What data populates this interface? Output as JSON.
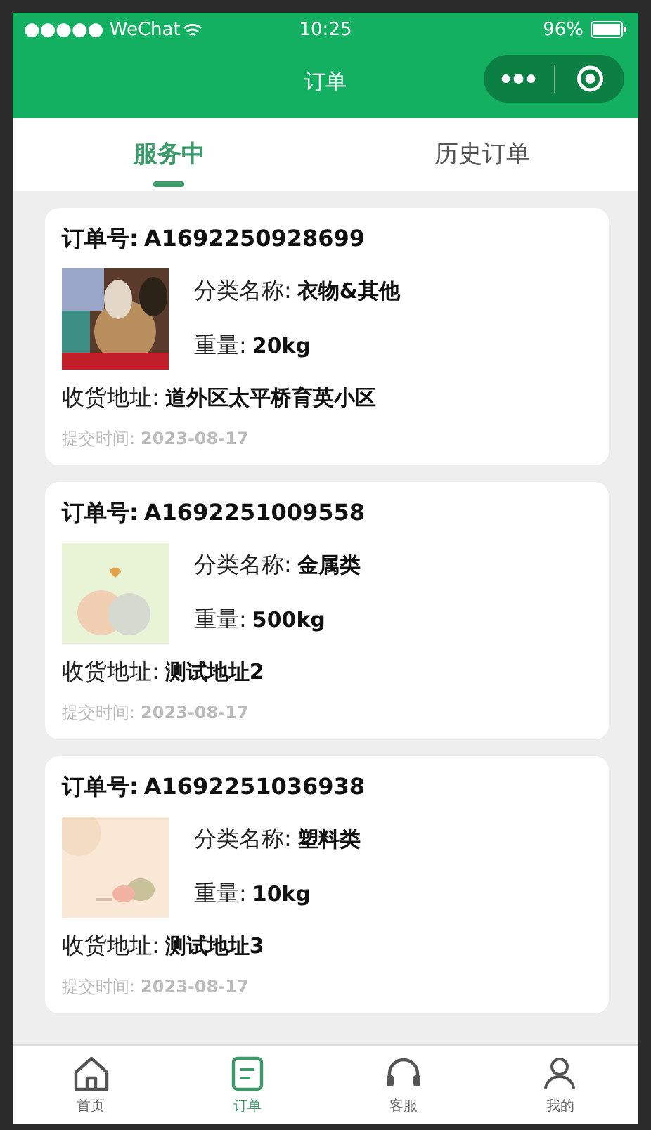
{
  "status_bar": {
    "carrier": "●●●●● WeChat",
    "time": "10:25",
    "battery": "96%"
  },
  "nav_bar": {
    "title": "订单"
  },
  "tabs": [
    {
      "label": "服务中",
      "selected": true
    },
    {
      "label": "历史订单",
      "selected": false
    }
  ],
  "orders": [
    {
      "order_label": "订单号:",
      "order_no": "A1692250928699",
      "category_label": "分类名称:",
      "category": "衣物&其他",
      "weight_label": "重量:",
      "weight": "20kg",
      "address_label": "收货地址:",
      "address": "道外区太平桥育英小区",
      "time_label": "提交时间:",
      "time": "2023-08-17"
    },
    {
      "order_label": "订单号:",
      "order_no": "A1692251009558",
      "category_label": "分类名称:",
      "category": "金属类",
      "weight_label": "重量:",
      "weight": "500kg",
      "address_label": "收货地址:",
      "address": "测试地址2",
      "time_label": "提交时间:",
      "time": "2023-08-17"
    },
    {
      "order_label": "订单号:",
      "order_no": "A1692251036938",
      "category_label": "分类名称:",
      "category": "塑料类",
      "weight_label": "重量:",
      "weight": "10kg",
      "address_label": "收货地址:",
      "address": "测试地址3",
      "time_label": "提交时间:",
      "time": "2023-08-17"
    }
  ],
  "tab_bar": [
    {
      "label": "首页",
      "kind": "home",
      "selected": false
    },
    {
      "label": "订单",
      "kind": "order",
      "selected": true
    },
    {
      "label": "客服",
      "kind": "headset",
      "selected": false
    },
    {
      "label": "我的",
      "kind": "user",
      "selected": false
    }
  ]
}
